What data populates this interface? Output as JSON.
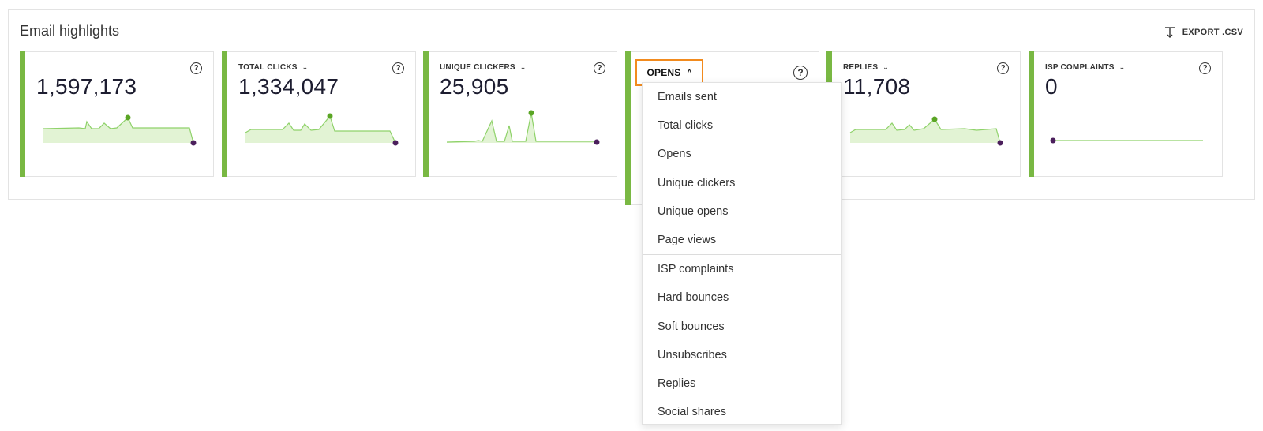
{
  "panel": {
    "title": "Email highlights",
    "export_label": "EXPORT .CSV",
    "export_icon": "export-icon"
  },
  "colors": {
    "accent_bar": "#79b843",
    "spark_fill": "#e2f3d4",
    "spark_line": "#8fd26a",
    "peak_dot": "#5aa524",
    "end_dot": "#4b1f5c",
    "highlight_border": "#f28b1e"
  },
  "cards": [
    {
      "metric": "",
      "value": "1,597,173",
      "chevron": "chevron-down-icon"
    },
    {
      "metric": "TOTAL CLICKS",
      "value": "1,334,047",
      "chevron": "chevron-down-icon"
    },
    {
      "metric": "UNIQUE CLICKERS",
      "value": "25,905",
      "chevron": "chevron-down-icon"
    },
    {
      "metric": "OPENS",
      "value": "",
      "chevron": "chevron-up-icon"
    },
    {
      "metric": "REPLIES",
      "value": "11,708",
      "chevron": "chevron-down-icon"
    },
    {
      "metric": "ISP COMPLAINTS",
      "value": "0",
      "chevron": "chevron-down-icon"
    }
  ],
  "help_icon": "?",
  "chevron_down": "⌄",
  "chevron_up": "^",
  "dropdown": {
    "group1": [
      "Emails sent",
      "Total clicks",
      "Opens",
      "Unique clickers",
      "Unique opens",
      "Page views"
    ],
    "group2": [
      "ISP complaints",
      "Hard bounces",
      "Soft bounces",
      "Unsubscribes",
      "Replies",
      "Social shares"
    ]
  }
}
